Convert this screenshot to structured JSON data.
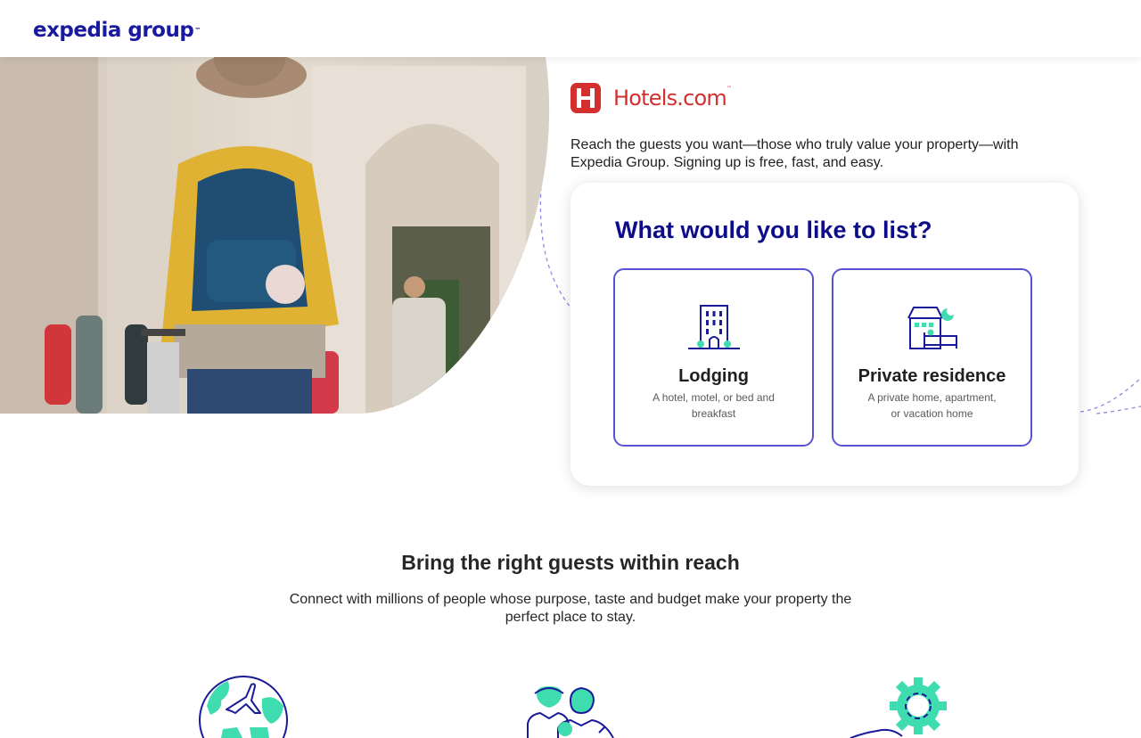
{
  "header": {
    "brand": "expedia group",
    "brand_tm": "™"
  },
  "hotels_logo": {
    "wordmark": "Hotels.com",
    "tm": "™"
  },
  "intro": "Reach the guests you want—those who truly value your property—with Expedia Group. Signing up is free, fast, and easy.",
  "list_card": {
    "title": "What would you like to list?",
    "options": [
      {
        "title": "Lodging",
        "description": "A hotel, motel, or bed and breakfast",
        "icon": "hotel-building-icon"
      },
      {
        "title": "Private residence",
        "description": "A private home, apartment, or vacation home",
        "icon": "house-icon"
      }
    ]
  },
  "section": {
    "title": "Bring the right guests within reach",
    "description": "Connect with millions of people whose purpose, taste and budget make your property the perfect place to stay."
  },
  "features": [
    {
      "icon": "globe-plane-icon"
    },
    {
      "icon": "people-icon"
    },
    {
      "icon": "gear-hand-icon"
    }
  ],
  "colors": {
    "brand_navy": "#1a1aa0",
    "title_navy": "#0d0d8a",
    "accent_purple": "#5a52d5",
    "teal": "#3fdcb0",
    "hotels_red": "#d32f2f"
  }
}
